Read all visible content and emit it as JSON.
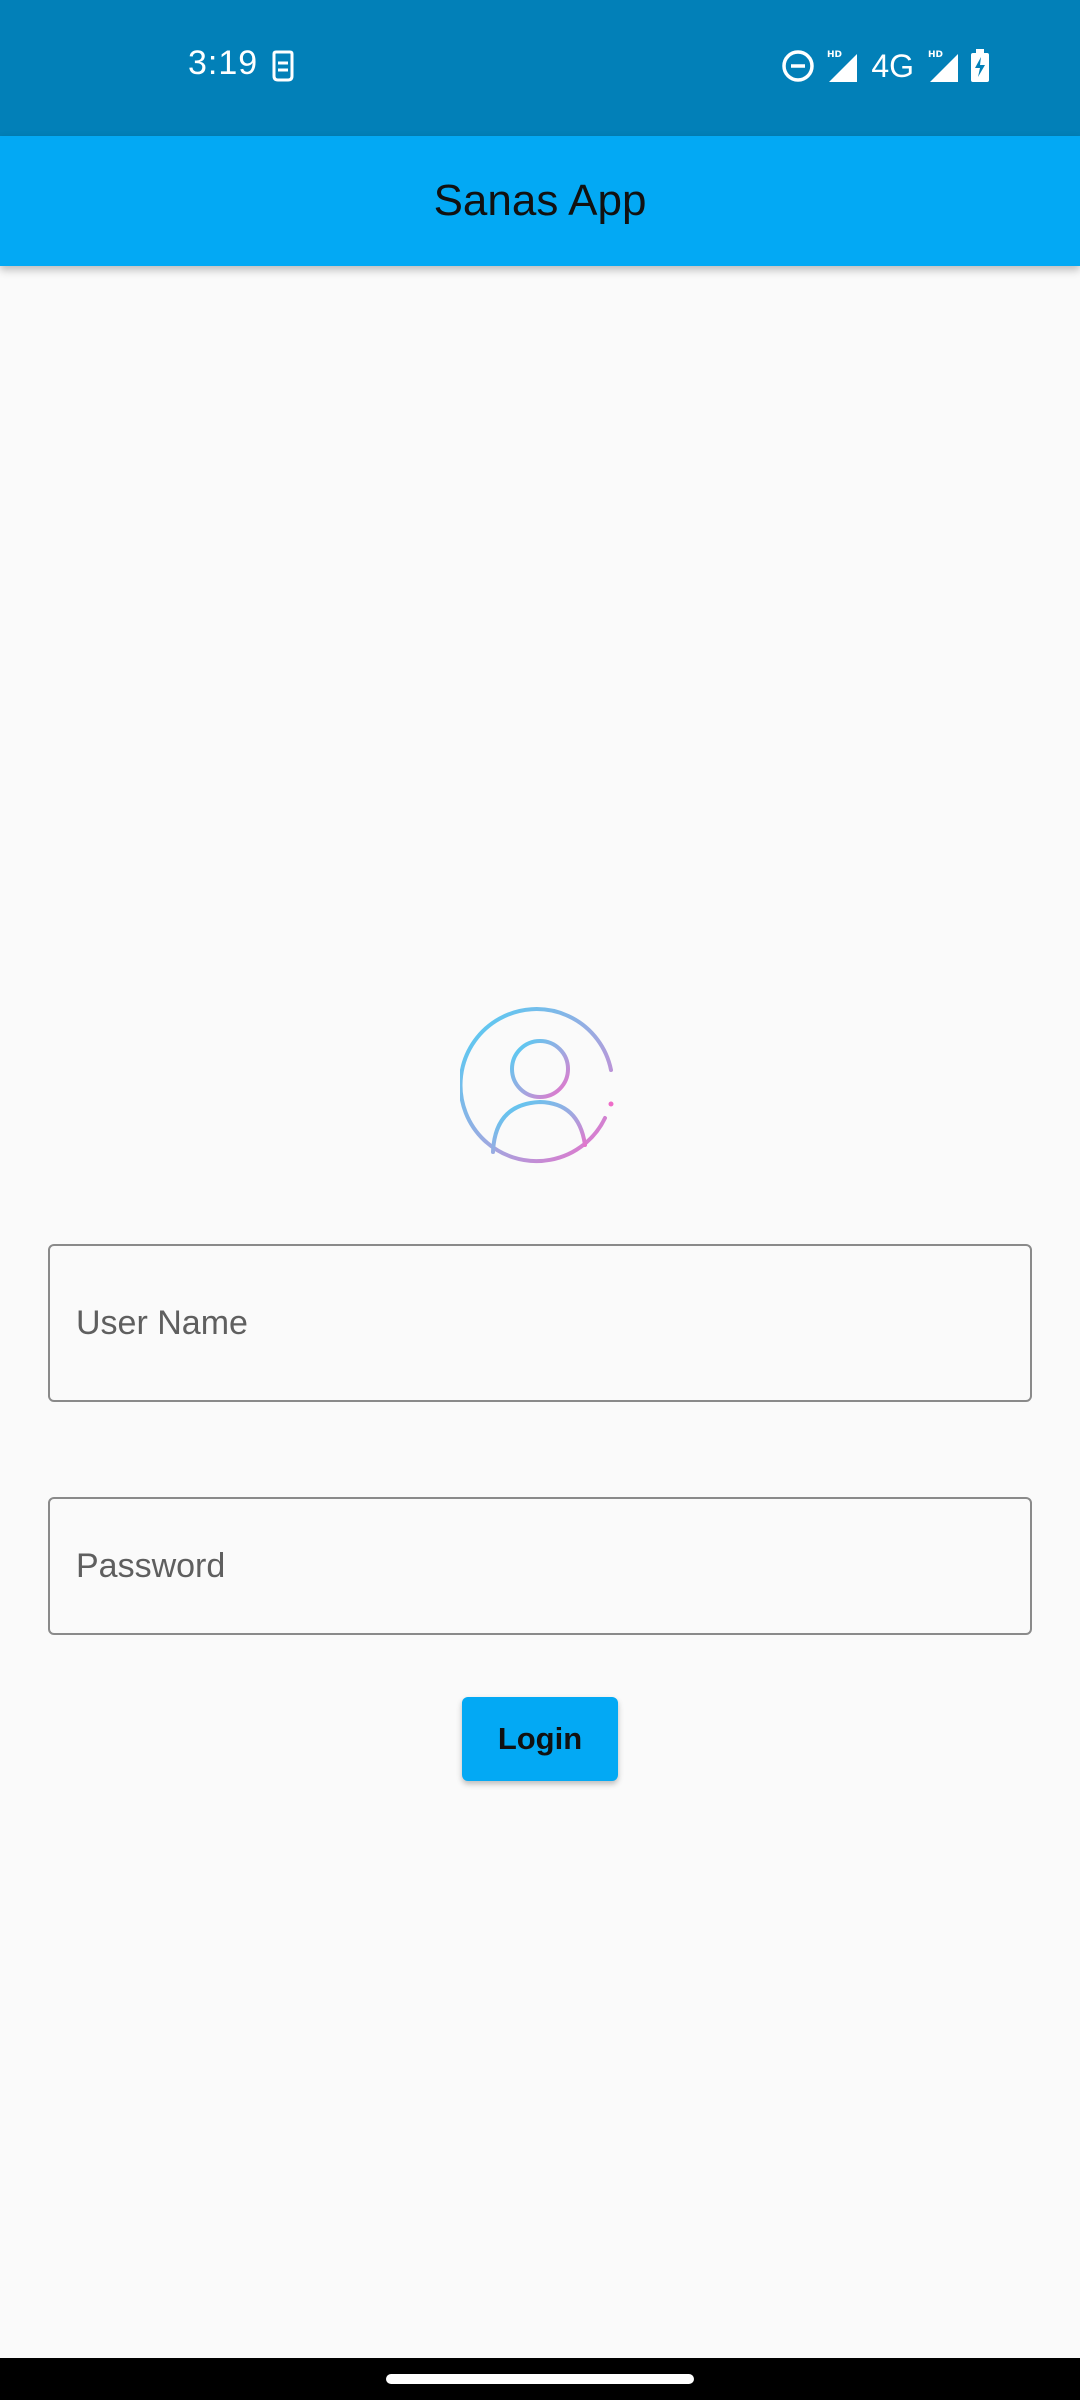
{
  "status_bar": {
    "time": "3:19",
    "network": "4G",
    "icons": [
      "sim-icon",
      "dnd-icon",
      "hd-signal-icon",
      "signal-icon",
      "battery-charging-icon"
    ]
  },
  "app_bar": {
    "title": "Sanas App"
  },
  "login_form": {
    "username_placeholder": "User Name",
    "password_placeholder": "Password",
    "login_label": "Login"
  },
  "colors": {
    "status_bar": "#0280b8",
    "app_bar": "#03a9f4",
    "button": "#03a9f4",
    "background": "#fafafa",
    "avatar_gradient_start": "#4dd0f5",
    "avatar_gradient_end": "#ee6cc8"
  }
}
